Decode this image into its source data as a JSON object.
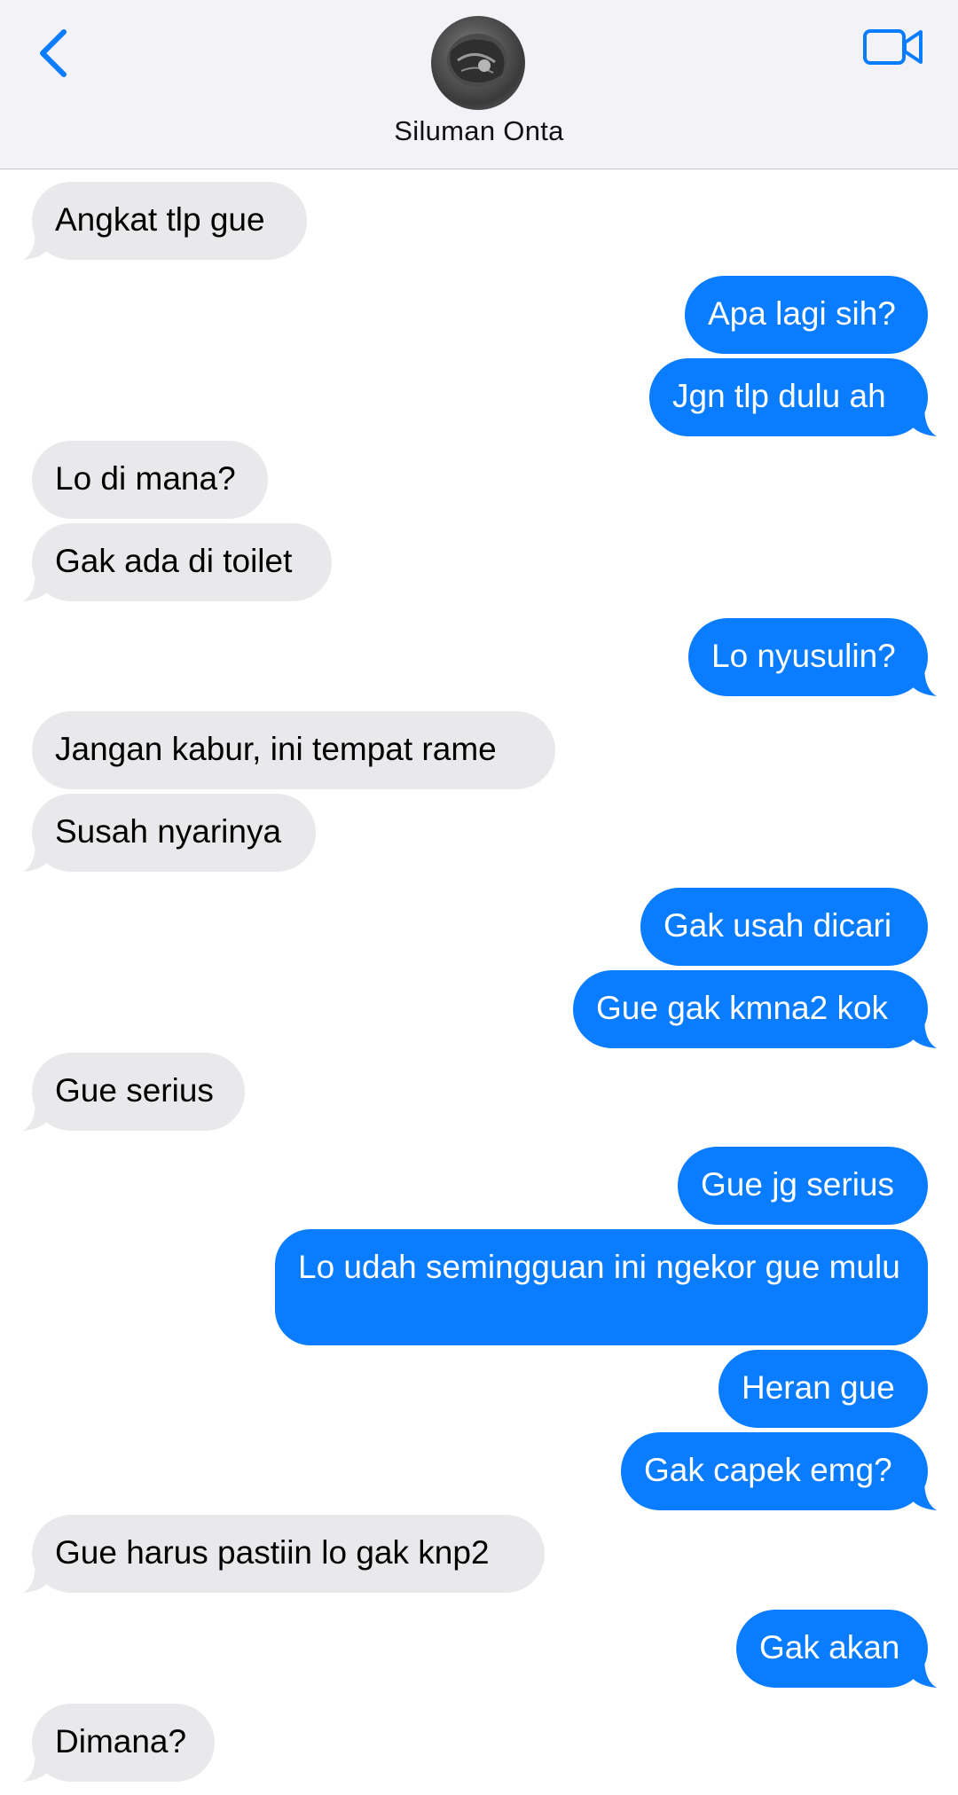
{
  "header": {
    "contact_name": "Siluman Onta",
    "back_icon": "chevron-left-icon",
    "video_icon": "video-camera-icon",
    "accent_color": "#0a7cff"
  },
  "messages": [
    {
      "dir": "in",
      "text": "Angkat tlp gue"
    },
    {
      "dir": "out",
      "text": "Apa lagi sih?"
    },
    {
      "dir": "out",
      "text": "Jgn tlp dulu ah"
    },
    {
      "dir": "in",
      "text": "Lo di mana?"
    },
    {
      "dir": "in",
      "text": "Gak ada di toilet"
    },
    {
      "dir": "out",
      "text": "Lo nyusulin?"
    },
    {
      "dir": "in",
      "text": "Jangan kabur, ini tempat rame"
    },
    {
      "dir": "in",
      "text": "Susah nyarinya"
    },
    {
      "dir": "out",
      "text": "Gak usah dicari"
    },
    {
      "dir": "out",
      "text": "Gue gak kmna2 kok"
    },
    {
      "dir": "in",
      "text": "Gue serius"
    },
    {
      "dir": "out",
      "text": "Gue jg serius"
    },
    {
      "dir": "out",
      "text": "Lo udah semingguan ini ngekor gue mulu"
    },
    {
      "dir": "out",
      "text": "Heran gue"
    },
    {
      "dir": "out",
      "text": "Gak capek emg?"
    },
    {
      "dir": "in",
      "text": "Gue harus pastiin lo gak knp2"
    },
    {
      "dir": "out",
      "text": "Gak akan"
    },
    {
      "dir": "in",
      "text": "Dimana?"
    }
  ]
}
